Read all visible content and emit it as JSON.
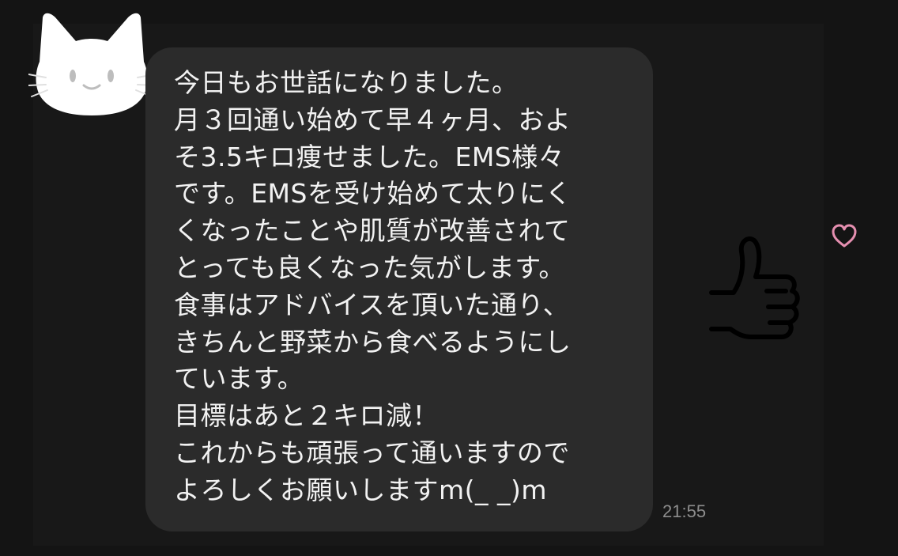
{
  "message": {
    "lines": [
      "今日もお世話になりました。",
      "月３回通い始めて早４ヶ月、およ",
      "そ3.5キロ痩せました。EMS様々",
      "です。EMSを受け始めて太りにく",
      "くなったことや肌質が改善されて",
      "とっても良くなった気がします。",
      "食事はアドバイスを頂いた通り、",
      "きちんと野菜から食べるようにし",
      "ています。",
      "目標はあと２キロ減！",
      "これからも頑張って通いますので",
      "よろしくお願いしますm(_ _)m"
    ],
    "timestamp": "21:55"
  },
  "avatar": {
    "icon": "white-cat-face-icon"
  },
  "reactions": {
    "thumbs_up_icon": "thumbs-up-sketch-icon",
    "heart_icon": "heart-icon",
    "heart_color": "#e58fb0"
  },
  "colors": {
    "background": "#141414",
    "bubble": "#2b2b2b",
    "text": "#f2f2f2",
    "timestamp": "#8d8d8d"
  }
}
